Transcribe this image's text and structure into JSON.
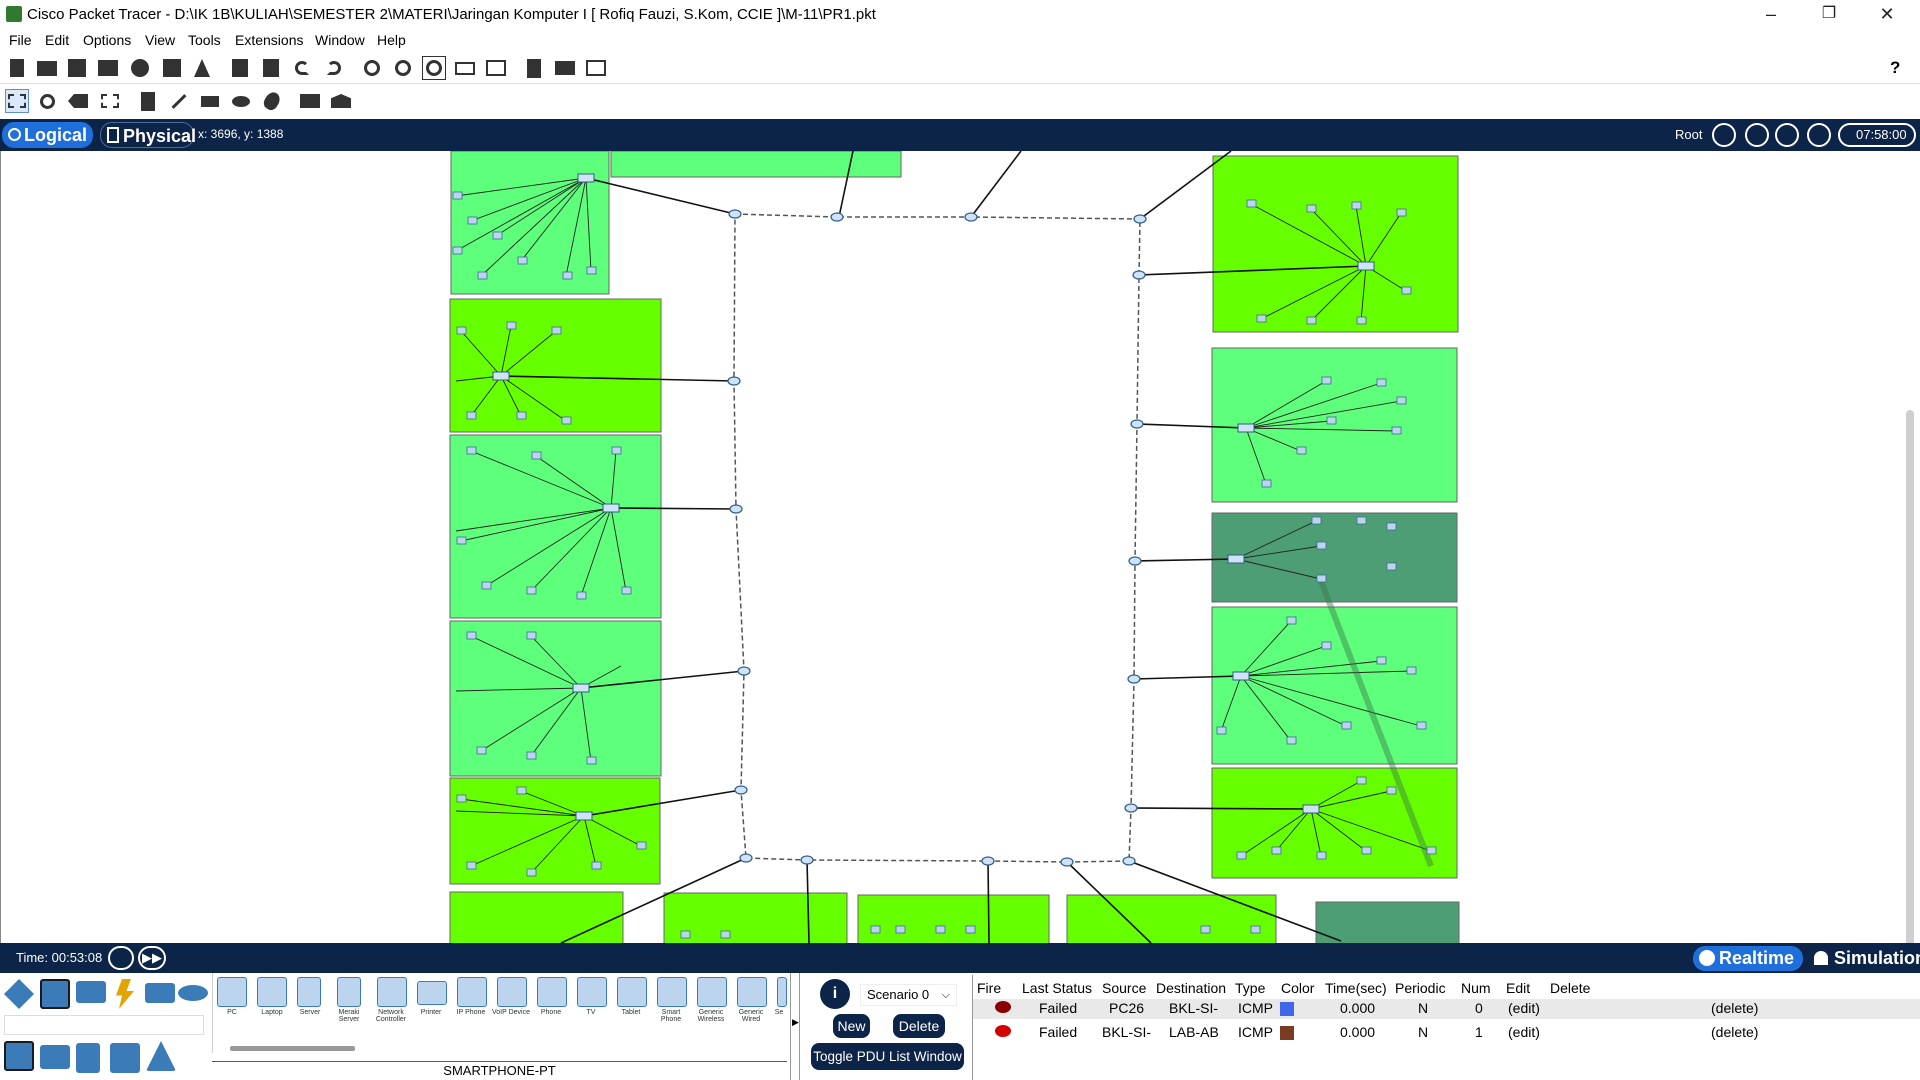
{
  "window": {
    "title": "Cisco Packet Tracer - D:\\IK 1B\\KULIAH\\SEMESTER 2\\MATERI\\Jaringan Komputer I [ Rofiq Fauzi, S.Kom, CCIE ]\\M-11\\PR1.pkt",
    "minimize": "–",
    "restore": "❐",
    "close": "✕"
  },
  "menu": [
    "File",
    "Edit",
    "Options",
    "View",
    "Tools",
    "Extensions",
    "Window",
    "Help"
  ],
  "toolbar": {
    "help": "?"
  },
  "nav": {
    "logical": "Logical",
    "physical": "Physical",
    "coords": "x: 3696, y: 1388",
    "root": "Root",
    "clock": "07:58:00"
  },
  "status": {
    "time": "Time: 00:53:08",
    "realtime": "Realtime",
    "simulation": "Simulation"
  },
  "devices": {
    "items": [
      "PC",
      "Laptop",
      "Server",
      "Meraki Server",
      "Network Controller",
      "Printer",
      "IP Phone",
      "VoIP Device",
      "Phone",
      "TV",
      "Tablet",
      "Smart Phone",
      "Generic Wireless",
      "Generic Wired",
      "Se"
    ],
    "selected_label": "SMARTPHONE-PT"
  },
  "scenario": {
    "info": "i",
    "selected": "Scenario 0",
    "new": "New",
    "delete": "Delete",
    "toggle": "Toggle PDU List Window"
  },
  "pdu": {
    "headers": [
      "Fire",
      "Last Status",
      "Source",
      "Destination",
      "Type",
      "Color",
      "Time(sec)",
      "Periodic",
      "Num",
      "Edit",
      "Delete"
    ],
    "rows": [
      {
        "status": "Failed",
        "source": "PC26",
        "destination": "BKL-SI-",
        "type": "ICMP",
        "color": "#3f67e8",
        "time": "0.000",
        "periodic": "N",
        "num": "0",
        "edit": "(edit)",
        "delete": "(delete)"
      },
      {
        "status": "Failed",
        "source": "BKL-SI-",
        "destination": "LAB-AB",
        "type": "ICMP",
        "color": "#7a3b20",
        "time": "0.000",
        "periodic": "N",
        "num": "1",
        "edit": "(edit)",
        "delete": "(delete)"
      }
    ]
  }
}
